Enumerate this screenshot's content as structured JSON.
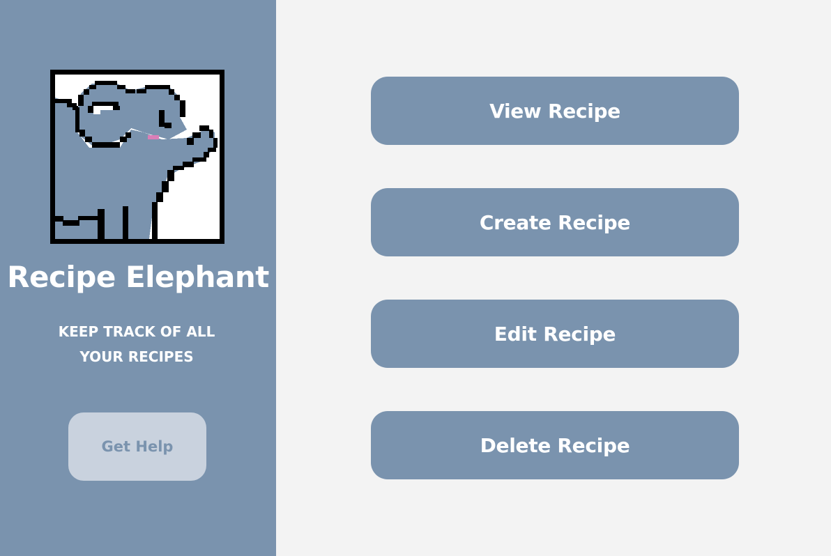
{
  "sidebar": {
    "app_title": "Recipe Elephant",
    "tagline_line1": "KEEP TRACK OF ALL",
    "tagline_line2": "YOUR RECIPES",
    "help_label": "Get Help",
    "logo_icon": "pixel-elephant-icon"
  },
  "actions": {
    "view_label": "View Recipe",
    "create_label": "Create Recipe",
    "edit_label": "Edit Recipe",
    "delete_label": "Delete Recipe"
  },
  "colors": {
    "sidebar_bg": "#7a93ae",
    "main_bg": "#f3f3f3",
    "button_bg": "#7a93ae",
    "help_button_bg": "#c9d2de",
    "text_light": "#ffffff",
    "elephant_cheek": "#d97fb8"
  }
}
